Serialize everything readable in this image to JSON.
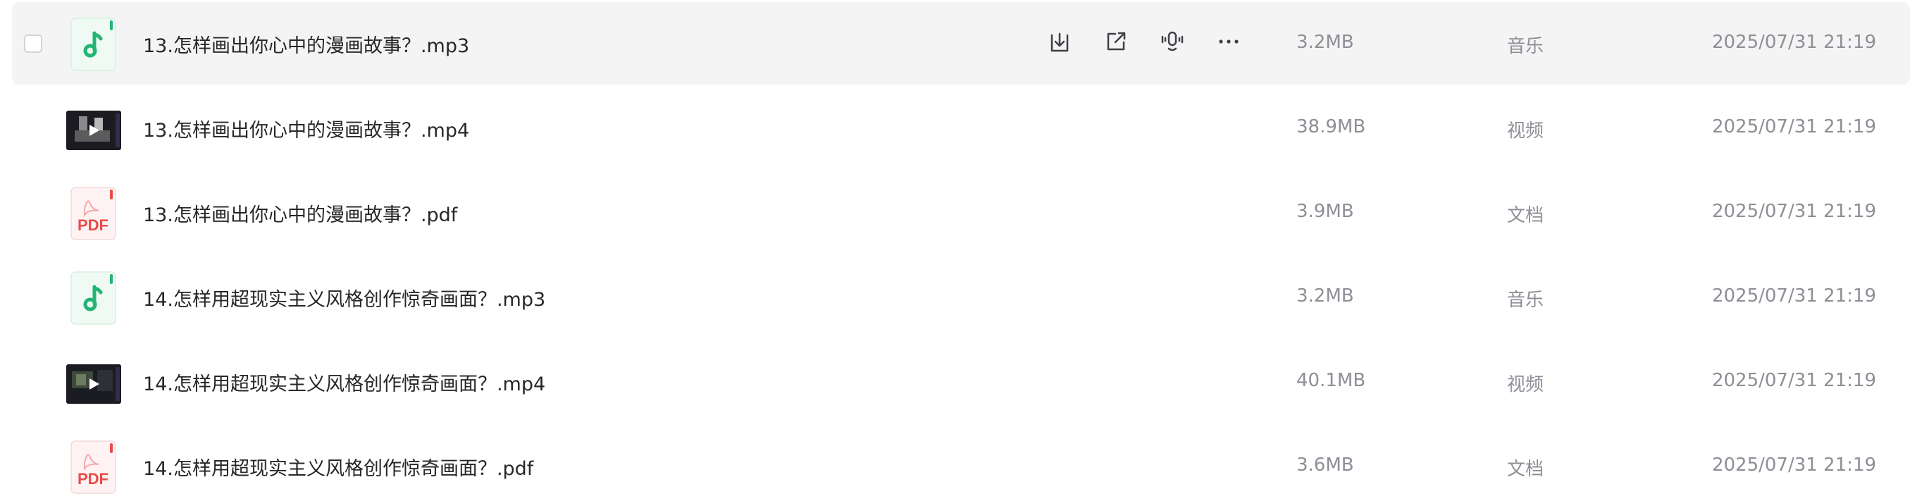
{
  "files": [
    {
      "name": "13.怎样画出你心中的漫画故事？.mp3",
      "size": "3.2MB",
      "type": "音乐",
      "time": "2025/07/31 21:19",
      "kind": "audio",
      "icon": "music-note-icon",
      "hovered": true
    },
    {
      "name": "13.怎样画出你心中的漫画故事？.mp4",
      "size": "38.9MB",
      "type": "视频",
      "time": "2025/07/31 21:19",
      "kind": "video",
      "icon": "video-thumbnail"
    },
    {
      "name": "13.怎样画出你心中的漫画故事？.pdf",
      "size": "3.9MB",
      "type": "文档",
      "time": "2025/07/31 21:19",
      "kind": "pdf",
      "icon": "pdf-icon"
    },
    {
      "name": "14.怎样用超现实主义风格创作惊奇画面？.mp3",
      "size": "3.2MB",
      "type": "音乐",
      "time": "2025/07/31 21:19",
      "kind": "audio",
      "icon": "music-note-icon"
    },
    {
      "name": "14.怎样用超现实主义风格创作惊奇画面？.mp4",
      "size": "40.1MB",
      "type": "视频",
      "time": "2025/07/31 21:19",
      "kind": "video",
      "icon": "video-thumbnail"
    },
    {
      "name": "14.怎样用超现实主义风格创作惊奇画面？.pdf",
      "size": "3.6MB",
      "type": "文档",
      "time": "2025/07/31 21:19",
      "kind": "pdf",
      "icon": "pdf-icon"
    }
  ],
  "row_actions": [
    "download-icon",
    "share-icon",
    "voice-icon",
    "more-icon"
  ],
  "pdf_label": "PDF",
  "colors": {
    "audio_green": "#22b573",
    "audio_bg": "#eefaf3",
    "pdf_red": "#e94b4b",
    "pdf_bg": "#fff2f2",
    "hover_bg": "#f4f4f5",
    "text_primary": "#27272a",
    "text_secondary": "#8e8e96"
  }
}
